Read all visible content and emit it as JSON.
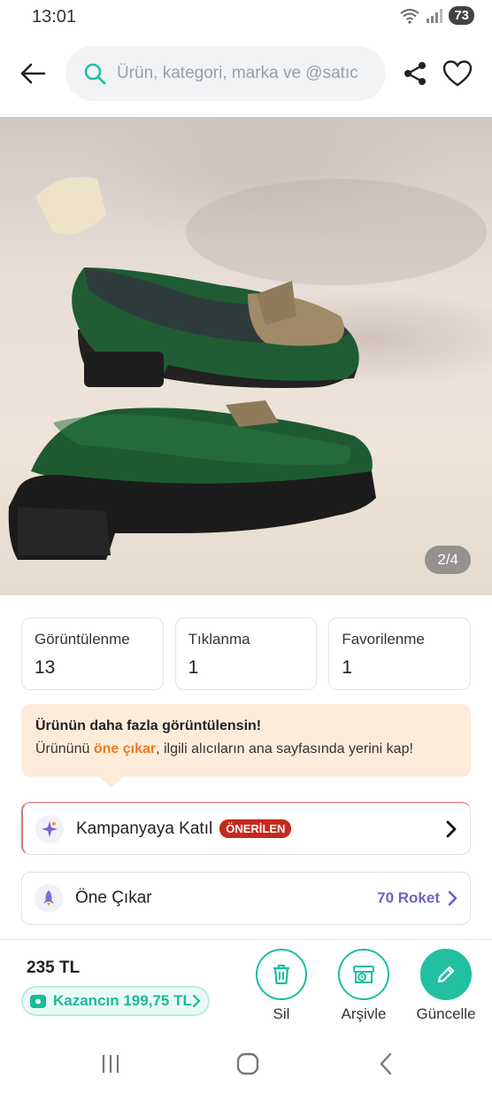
{
  "status_bar": {
    "time": "13:01",
    "battery": "73"
  },
  "search": {
    "placeholder": "Ürün, kategori, marka ve @satıc"
  },
  "photo": {
    "counter": "2/4"
  },
  "stats": [
    {
      "label": "Görüntülenme",
      "value": "13"
    },
    {
      "label": "Tıklanma",
      "value": "1"
    },
    {
      "label": "Favorilenme",
      "value": "1"
    }
  ],
  "promo": {
    "title": "Ürünün daha fazla görüntülensin!",
    "text_before": "Ürününü ",
    "highlight": "öne çıkar",
    "text_after": ", ilgili alıcıların ana sayfasında yerini kap!"
  },
  "options": {
    "campaign": {
      "label": "Kampanyaya Katıl",
      "badge": "ÖNERİLEN"
    },
    "feature": {
      "label": "Öne Çıkar",
      "cost": "70 Roket"
    }
  },
  "bottom": {
    "price": "235 TL",
    "earning": "Kazancın 199,75 TL",
    "actions": {
      "delete": "Sil",
      "archive": "Arşivle",
      "update": "Güncelle"
    }
  },
  "colors": {
    "accent": "#20c0a0",
    "promo_bg": "#fdecd9",
    "highlight": "#f07820",
    "badge": "#c7281e",
    "roket": "#6b63c7"
  }
}
